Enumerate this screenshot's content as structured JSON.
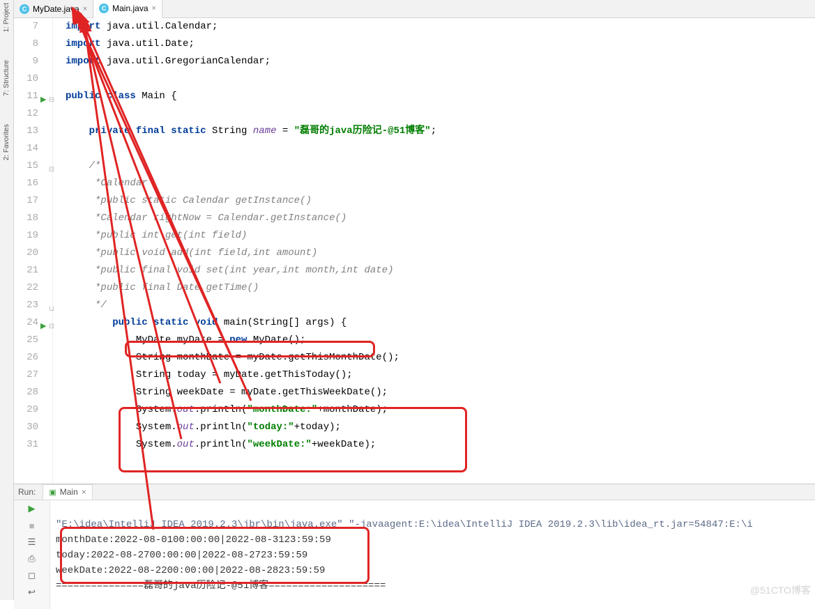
{
  "sidebar": {
    "project_label": "1: Project",
    "structure_label": "7: Structure",
    "favorites_label": "2: Favorites"
  },
  "tabs": [
    {
      "icon": "C",
      "label": "MyDate.java"
    },
    {
      "icon": "C",
      "label": "Main.java"
    }
  ],
  "gutter": {
    "start": 7,
    "end": 31,
    "run_markers": [
      11,
      24
    ]
  },
  "code": {
    "l7": {
      "kw": "import",
      "rest": " java.util.Calendar;"
    },
    "l8": {
      "kw": "import",
      "rest": " java.util.Date;"
    },
    "l9": {
      "kw": "import",
      "rest": " java.util.GregorianCalendar;"
    },
    "l11": {
      "kw1": "public class",
      "name": " Main {"
    },
    "l13": {
      "kw": "private final static",
      "type": " String ",
      "field": "name",
      "eq": " = ",
      "str": "\"磊哥的java历险记-@51博客\"",
      "end": ";"
    },
    "l15": "/*",
    "l16": " *Calendar",
    "l17": " *public static Calendar getInstance()",
    "l18": " *Calendar rightNow = Calendar.getInstance()",
    "l19": " *public int get(int field)",
    "l20": " *public void add(int field,int amount)",
    "l21": " *public final void set(int year,int month,int date)",
    "l22": " *public final Date getTime()",
    "l23": " */",
    "l24": {
      "kw": "public static void",
      "rest": " main(String[] args) {"
    },
    "l25": {
      "p1": "MyDate myDate = ",
      "kw": "new",
      "p2": " MyDate();"
    },
    "l26": "String monthDate = myDate.getThisMonthDate();",
    "l27": "String today = myDate.getThisToday();",
    "l28": "String weekDate = myDate.getThisWeekDate();",
    "l29": {
      "p1": "System.",
      "out": "out",
      "p2": ".println(",
      "str": "\"monthDate:\"",
      "p3": "+monthDate);"
    },
    "l30": {
      "p1": "System.",
      "out": "out",
      "p2": ".println(",
      "str": "\"today:\"",
      "p3": "+today);"
    },
    "l31": {
      "p1": "System.",
      "out": "out",
      "p2": ".println(",
      "str": "\"weekDate:\"",
      "p3": "+weekDate);"
    }
  },
  "run": {
    "title": "Run:",
    "tab": "Main",
    "cmd": "\"E:\\idea\\IntelliJ IDEA 2019.2.3\\jbr\\bin\\java.exe\" \"-javaagent:E:\\idea\\IntelliJ IDEA 2019.2.3\\lib\\idea_rt.jar=54847:E:\\i",
    "out1": "monthDate:2022-08-0100:00:00|2022-08-3123:59:59",
    "out2": "today:2022-08-2700:00:00|2022-08-2723:59:59",
    "out3": "weekDate:2022-08-2200:00:00|2022-08-2823:59:59",
    "out4": "===============磊哥的java历险记-@51博客===================="
  },
  "watermark": "@51CTO博客"
}
